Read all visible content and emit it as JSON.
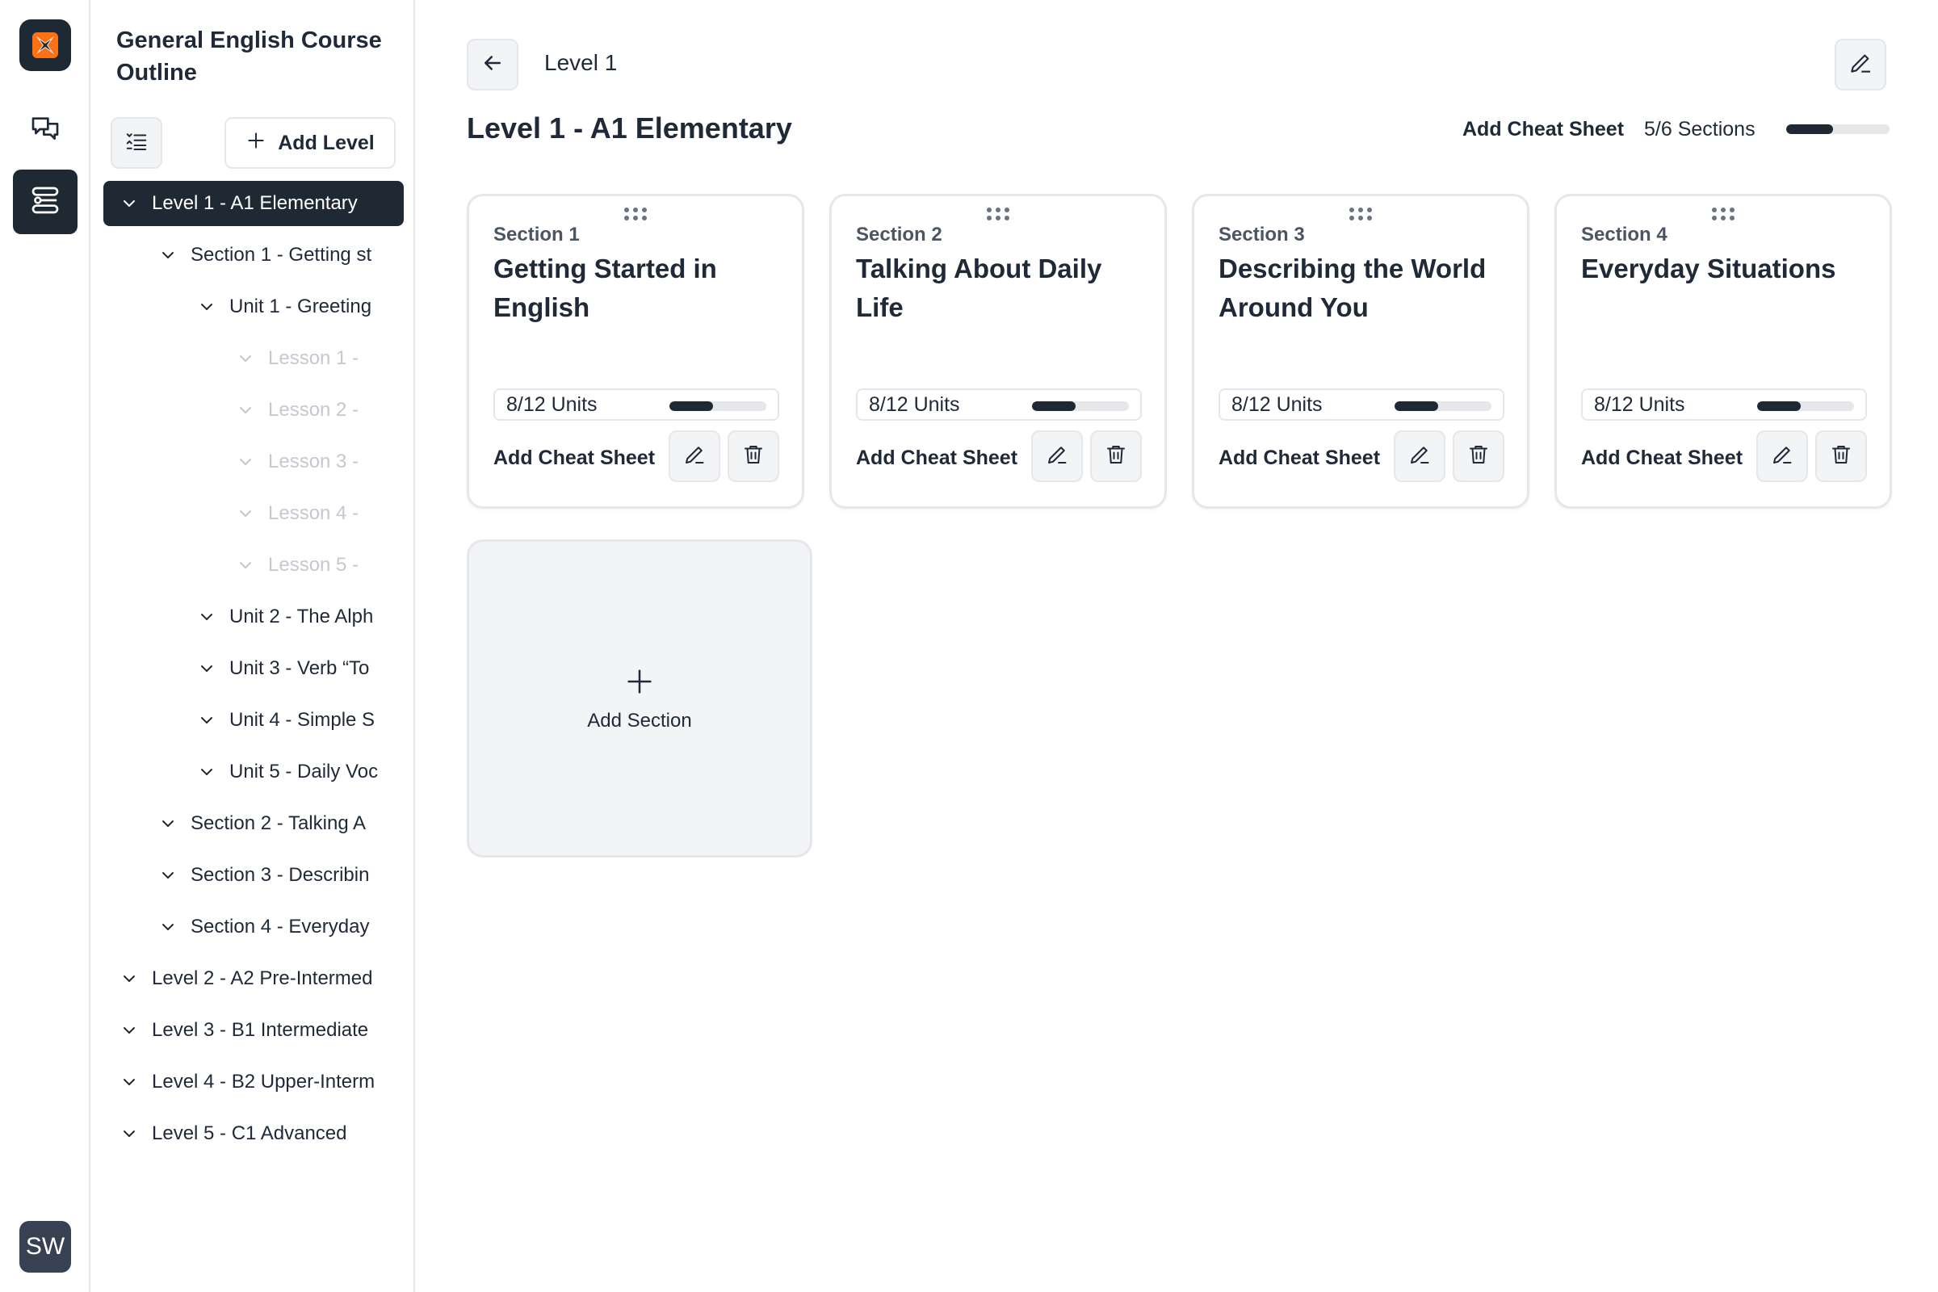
{
  "rail": {
    "logo_icon": "app-logo",
    "items": [
      {
        "icon": "chat-icon",
        "active": false
      },
      {
        "icon": "workflow-icon",
        "active": true
      }
    ],
    "avatar_initials": "SW"
  },
  "outline": {
    "title": "General English Course Outline",
    "add_level_label": "Add Level",
    "tree": [
      {
        "label": "Level 1 - A1 Elementary",
        "depth": 0,
        "selected": true,
        "muted": false
      },
      {
        "label": "Section 1 - Getting st",
        "depth": 1,
        "selected": false,
        "muted": false
      },
      {
        "label": "Unit 1 - Greeting",
        "depth": 2,
        "selected": false,
        "muted": false
      },
      {
        "label": "Lesson 1 -",
        "depth": 3,
        "selected": false,
        "muted": true
      },
      {
        "label": "Lesson 2 -",
        "depth": 3,
        "selected": false,
        "muted": true
      },
      {
        "label": "Lesson 3 -",
        "depth": 3,
        "selected": false,
        "muted": true
      },
      {
        "label": "Lesson 4 -",
        "depth": 3,
        "selected": false,
        "muted": true
      },
      {
        "label": "Lesson 5 -",
        "depth": 3,
        "selected": false,
        "muted": true
      },
      {
        "label": "Unit 2 - The Alph",
        "depth": 2,
        "selected": false,
        "muted": false
      },
      {
        "label": "Unit 3 - Verb “To",
        "depth": 2,
        "selected": false,
        "muted": false
      },
      {
        "label": "Unit 4 - Simple S",
        "depth": 2,
        "selected": false,
        "muted": false
      },
      {
        "label": "Unit 5 - Daily Voc",
        "depth": 2,
        "selected": false,
        "muted": false
      },
      {
        "label": "Section 2 - Talking A",
        "depth": 1,
        "selected": false,
        "muted": false
      },
      {
        "label": "Section 3 - Describin",
        "depth": 1,
        "selected": false,
        "muted": false
      },
      {
        "label": "Section 4 - Everyday",
        "depth": 1,
        "selected": false,
        "muted": false
      },
      {
        "label": "Level 2 - A2 Pre-Intermed",
        "depth": 0,
        "selected": false,
        "muted": false
      },
      {
        "label": "Level 3 - B1 Intermediate",
        "depth": 0,
        "selected": false,
        "muted": false
      },
      {
        "label": "Level 4 - B2 Upper-Interm",
        "depth": 0,
        "selected": false,
        "muted": false
      },
      {
        "label": "Level 5 - C1 Advanced",
        "depth": 0,
        "selected": false,
        "muted": false
      }
    ]
  },
  "main": {
    "breadcrumb": "Level 1",
    "title": "Level 1 - A1 Elementary",
    "cheat_sheet_label": "Add Cheat Sheet",
    "sections_progress_label": "5/6 Sections",
    "sections_progress": 0.45,
    "add_section_label": "Add Section",
    "sections": [
      {
        "number": "Section 1",
        "title": "Getting Started in English",
        "units_label": "8/12 Units",
        "units_progress": 0.45,
        "cheat_label": "Add Cheat Sheet"
      },
      {
        "number": "Section 2",
        "title": "Talking About Daily Life",
        "units_label": "8/12 Units",
        "units_progress": 0.45,
        "cheat_label": "Add Cheat Sheet"
      },
      {
        "number": "Section 3",
        "title": "Describing the World Around You",
        "units_label": "8/12 Units",
        "units_progress": 0.45,
        "cheat_label": "Add Cheat Sheet"
      },
      {
        "number": "Section 4",
        "title": "Everyday Situations",
        "units_label": "8/12 Units",
        "units_progress": 0.45,
        "cheat_label": "Add Cheat Sheet"
      }
    ]
  },
  "colors": {
    "accent_dark": "#1f2933",
    "border": "#e5e7eb",
    "muted_text": "#c4c9d0",
    "logo_orange": "#f97316"
  }
}
